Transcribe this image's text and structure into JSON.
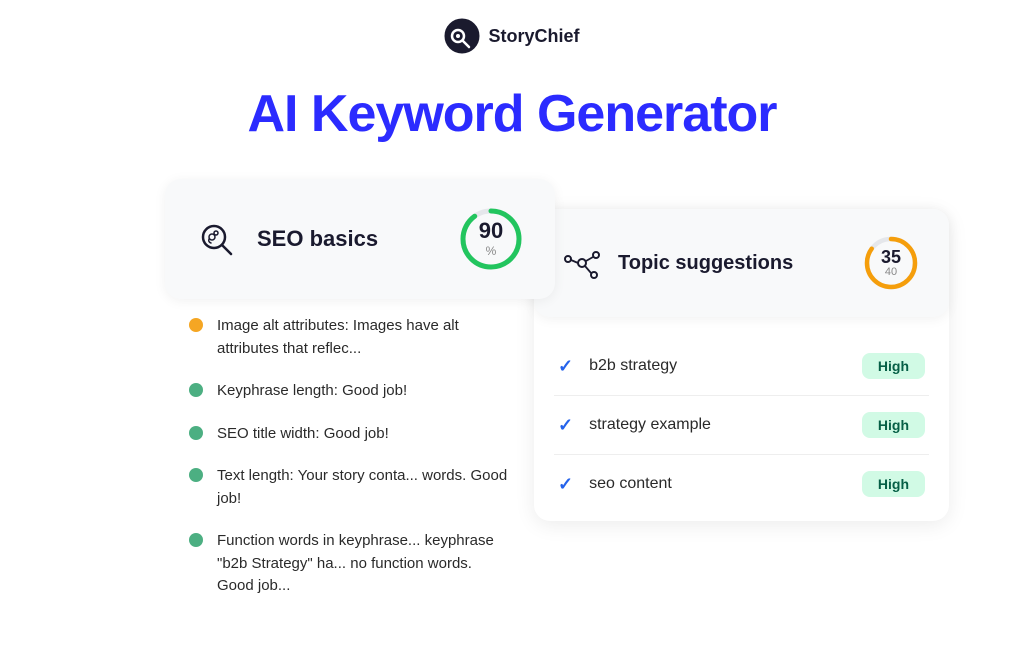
{
  "header": {
    "logo_text": "StoryChief"
  },
  "page": {
    "title": "AI Keyword Generator"
  },
  "seo_card": {
    "title": "SEO basics",
    "score": "90",
    "unit": "%",
    "score_color": "#22c55e",
    "score_total": 100,
    "score_value": 90
  },
  "seo_list": {
    "items": [
      {
        "dot_color": "orange",
        "text": "Image alt attributes: Images have alt attributes that reflec..."
      },
      {
        "dot_color": "green",
        "text": "Keyphrase length: Good job!"
      },
      {
        "dot_color": "green",
        "text": "SEO title width: Good job!"
      },
      {
        "dot_color": "green",
        "text": "Text length: Your story conta... words. Good job!"
      },
      {
        "dot_color": "green",
        "text": "Function words in keyphrase... keyphrase \"b2b Strategy\" ha... no function words. Good job..."
      }
    ]
  },
  "topic_suggestions": {
    "title": "Topic suggestions",
    "score": "35",
    "denom": "40",
    "score_color": "#f59e0b",
    "score_value": 35,
    "score_total": 40,
    "keywords": [
      {
        "label": "b2b strategy",
        "badge": "High",
        "checked": true
      },
      {
        "label": "strategy example",
        "badge": "High",
        "checked": true
      },
      {
        "label": "seo content",
        "badge": "High",
        "checked": true
      }
    ]
  }
}
